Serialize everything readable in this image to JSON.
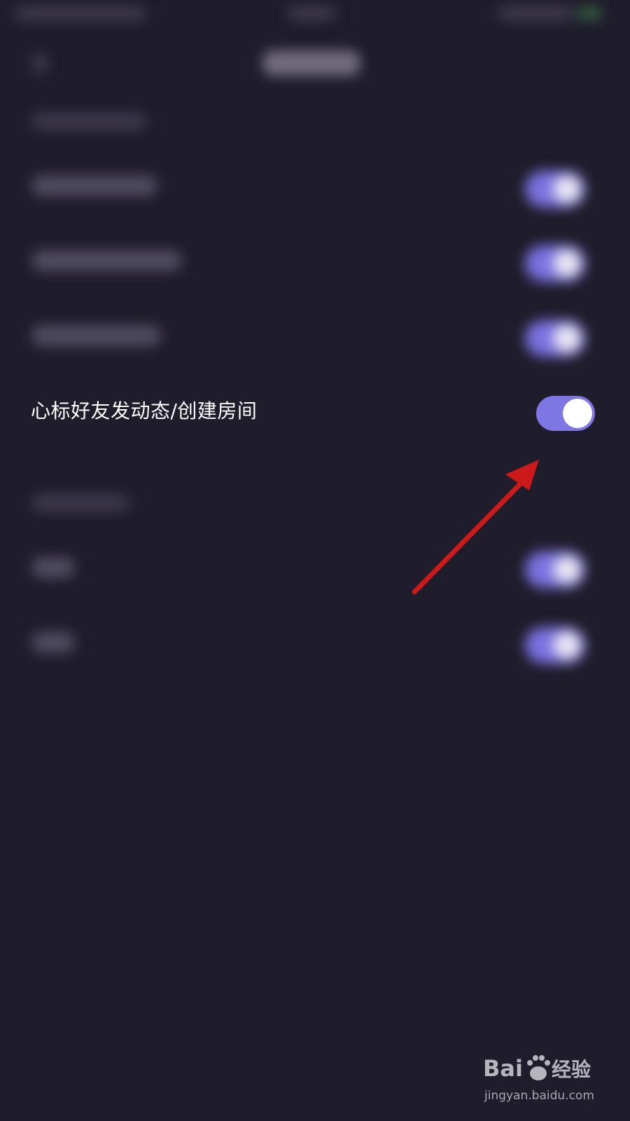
{
  "setting": {
    "label": "心标好友发动态/创建房间",
    "toggle_state": "on"
  },
  "colors": {
    "background": "#1f1c2b",
    "toggle_on": "#7d76e3",
    "toggle_knob": "#ffffff",
    "annotation_arrow": "#cc1a1a"
  },
  "watermark": {
    "logo_text": "Bai度经验",
    "url": "jingyan.baidu.com"
  }
}
